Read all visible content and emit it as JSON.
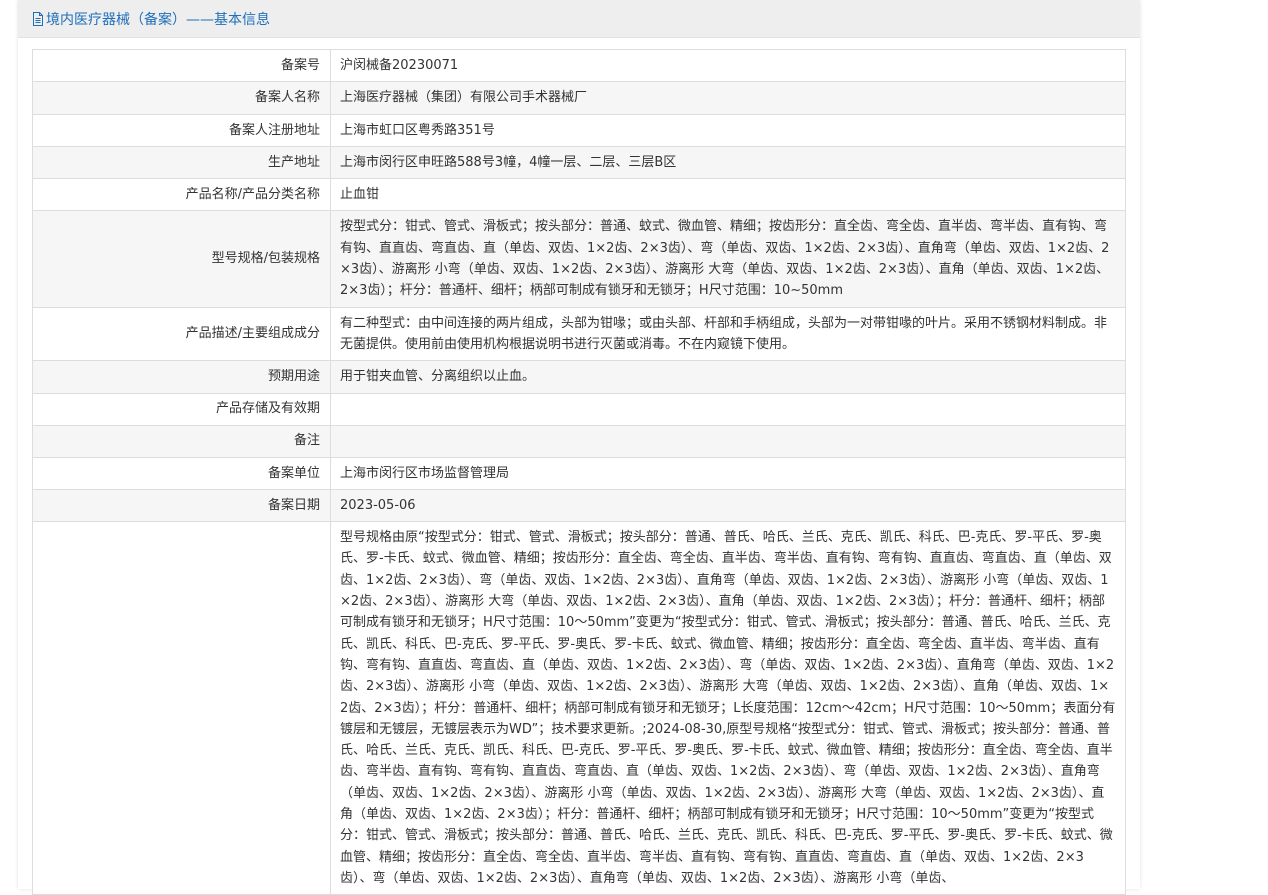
{
  "header": {
    "title": "境内医疗器械（备案）——基本信息",
    "icon": "document-icon",
    "accent_color": "#1f6fba"
  },
  "rows": [
    {
      "label": "备案号",
      "value": "沪闵械备20230071"
    },
    {
      "label": "备案人名称",
      "value": "上海医疗器械（集团）有限公司手术器械厂"
    },
    {
      "label": "备案人注册地址",
      "value": "上海市虹口区粤秀路351号"
    },
    {
      "label": "生产地址",
      "value": "上海市闵行区申旺路588号3幢，4幢一层、二层、三层B区"
    },
    {
      "label": "产品名称/产品分类名称",
      "value": "止血钳"
    },
    {
      "label": "型号规格/包装规格",
      "value": "按型式分：钳式、管式、滑板式；按头部分：普通、蚊式、微血管、精细；按齿形分：直全齿、弯全齿、直半齿、弯半齿、直有钩、弯有钩、直直齿、弯直齿、直（单齿、双齿、1×2齿、2×3齿）、弯（单齿、双齿、1×2齿、2×3齿）、直角弯（单齿、双齿、1×2齿、2×3齿）、游离形 小弯（单齿、双齿、1×2齿、2×3齿）、游离形 大弯（单齿、双齿、1×2齿、2×3齿）、直角（单齿、双齿、1×2齿、2×3齿）；杆分：普通杆、细杆；柄部可制成有锁牙和无锁牙；H尺寸范围：10~50mm"
    },
    {
      "label": "产品描述/主要组成成分",
      "value": "有二种型式：由中间连接的两片组成，头部为钳喙；或由头部、杆部和手柄组成，头部为一对带钳喙的叶片。采用不锈钢材料制成。非无菌提供。使用前由使用机构根据说明书进行灭菌或消毒。不在内窥镜下使用。"
    },
    {
      "label": "预期用途",
      "value": "用于钳夹血管、分离组织以止血。"
    },
    {
      "label": "产品存储及有效期",
      "value": ""
    },
    {
      "label": "备注",
      "value": ""
    },
    {
      "label": "备案单位",
      "value": "上海市闵行区市场监督管理局"
    },
    {
      "label": "备案日期",
      "value": "2023-05-06"
    },
    {
      "label": "",
      "value": "型号规格由原“按型式分：钳式、管式、滑板式；按头部分：普通、普氏、哈氏、兰氏、克氏、凯氏、科氏、巴-克氏、罗-平氏、罗-奥氏、罗-卡氏、蚊式、微血管、精细；按齿形分：直全齿、弯全齿、直半齿、弯半齿、直有钩、弯有钩、直直齿、弯直齿、直（单齿、双齿、1×2齿、2×3齿）、弯（单齿、双齿、1×2齿、2×3齿）、直角弯（单齿、双齿、1×2齿、2×3齿）、游离形 小弯（单齿、双齿、1×2齿、2×3齿）、游离形 大弯（单齿、双齿、1×2齿、2×3齿）、直角（单齿、双齿、1×2齿、2×3齿）；杆分：普通杆、细杆；柄部可制成有锁牙和无锁牙；H尺寸范围：10～50mm”变更为“按型式分：钳式、管式、滑板式；按头部分：普通、普氏、哈氏、兰氏、克氏、凯氏、科氏、巴-克氏、罗-平氏、罗-奥氏、罗-卡氏、蚊式、微血管、精细；按齿形分：直全齿、弯全齿、直半齿、弯半齿、直有钩、弯有钩、直直齿、弯直齿、直（单齿、双齿、1×2齿、2×3齿）、弯（单齿、双齿、1×2齿、2×3齿）、直角弯（单齿、双齿、1×2齿、2×3齿）、游离形 小弯（单齿、双齿、1×2齿、2×3齿）、游离形 大弯（单齿、双齿、1×2齿、2×3齿）、直角（单齿、双齿、1×2齿、2×3齿）；杆分：普通杆、细杆；柄部可制成有锁牙和无锁牙；L长度范围：12cm～42cm；H尺寸范围：10～50mm；表面分有镀层和无镀层，无镀层表示为WD”；技术要求更新。;2024-08-30,原型号规格“按型式分：钳式、管式、滑板式；按头部分：普通、普氏、哈氏、兰氏、克氏、凯氏、科氏、巴-克氏、罗-平氏、罗-奥氏、罗-卡氏、蚊式、微血管、精细；按齿形分：直全齿、弯全齿、直半齿、弯半齿、直有钩、弯有钩、直直齿、弯直齿、直（单齿、双齿、1×2齿、2×3齿）、弯（单齿、双齿、1×2齿、2×3齿）、直角弯（单齿、双齿、1×2齿、2×3齿）、游离形 小弯（单齿、双齿、1×2齿、2×3齿）、游离形 大弯（单齿、双齿、1×2齿、2×3齿）、直角（单齿、双齿、1×2齿、2×3齿）；杆分：普通杆、细杆；柄部可制成有锁牙和无锁牙；H尺寸范围：10～50mm”变更为“按型式分：钳式、管式、滑板式；按头部分：普通、普氏、哈氏、兰氏、克氏、凯氏、科氏、巴-克氏、罗-平氏、罗-奥氏、罗-卡氏、蚊式、微血管、精细；按齿形分：直全齿、弯全齿、直半齿、弯半齿、直有钩、弯有钩、直直齿、弯直齿、直（单齿、双齿、1×2齿、2×3齿）、弯（单齿、双齿、1×2齿、2×3齿）、直角弯（单齿、双齿、1×2齿、2×3齿）、游离形 小弯（单齿、"
    }
  ]
}
